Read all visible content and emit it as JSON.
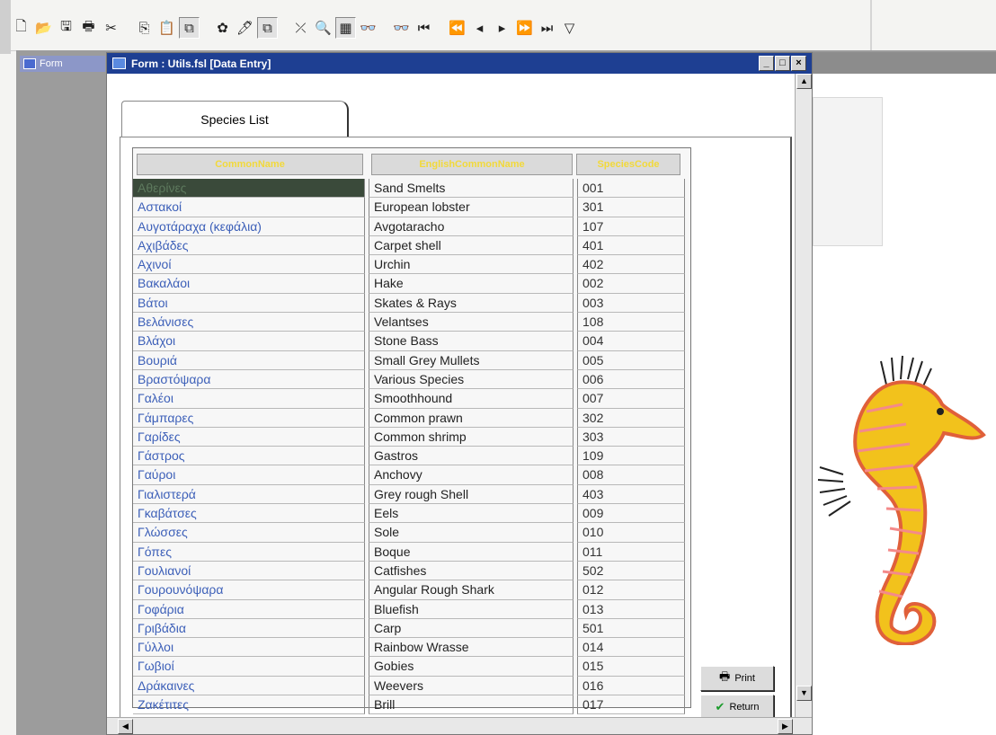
{
  "window": {
    "title": "Form : Utils.fsl [Data Entry]",
    "minimized_title": "Form",
    "controls": [
      "_",
      "□",
      "×"
    ]
  },
  "toolbar": {
    "icons": [
      "new-icon",
      "open-icon",
      "save-icon",
      "print-icon",
      "cut-icon",
      "copy-icon",
      "paste-icon",
      "form-view-icon",
      "layout-icon",
      "wand-icon",
      "filter-select-icon",
      "filter-edit-icon",
      "zoom-icon",
      "table-view-icon",
      "binoculars-icon",
      "find-replace-icon",
      "first-record-icon",
      "prev-page-icon",
      "prev-record-icon",
      "next-record-icon",
      "next-page-icon",
      "last-record-icon",
      "filter-icon"
    ],
    "glyphs": [
      "🗋",
      "📂",
      "🖫",
      "🖶",
      "✂",
      "⎘",
      "📋",
      "⧉",
      "✿",
      "🖊",
      "⧉",
      "⤫",
      "🔍",
      "▦",
      "👓",
      "👓",
      "⏮",
      "⏪",
      "◂",
      "▸",
      "⏩",
      "⏭",
      "▽"
    ]
  },
  "tab": {
    "label": "Species List"
  },
  "table": {
    "headers": [
      "CommonName",
      "EnglishCommonName",
      "SpeciesCode"
    ],
    "rows": [
      [
        "Αθερίνες",
        "Sand Smelts",
        "001"
      ],
      [
        "Αστακοί",
        "European lobster",
        "301"
      ],
      [
        "Αυγοτάραχα (κεφάλια)",
        "Avgotaracho",
        "107"
      ],
      [
        "Αχιβάδες",
        "Carpet shell",
        "401"
      ],
      [
        "Αχινοί",
        "Urchin",
        "402"
      ],
      [
        "Βακαλάοι",
        "Hake",
        "002"
      ],
      [
        "Βάτοι",
        "Skates & Rays",
        "003"
      ],
      [
        "Βελάνισες",
        "Velantses",
        "108"
      ],
      [
        "Βλάχοι",
        "Stone Bass",
        "004"
      ],
      [
        "Βουριά",
        "Small Grey Mullets",
        "005"
      ],
      [
        "Βραστόψαρα",
        "Various Species",
        "006"
      ],
      [
        "Γαλέοι",
        "Smoothhound",
        "007"
      ],
      [
        "Γάμπαρες",
        "Common prawn",
        "302"
      ],
      [
        "Γαρίδες",
        "Common shrimp",
        "303"
      ],
      [
        "Γάστρος",
        "Gastros",
        "109"
      ],
      [
        "Γαύροι",
        "Anchovy",
        "008"
      ],
      [
        "Γιαλιστερά",
        "Grey rough Shell",
        "403"
      ],
      [
        "Γκαβάτσες",
        "Eels",
        "009"
      ],
      [
        "Γλώσσες",
        "Sole",
        "010"
      ],
      [
        "Γόπες",
        "Boque",
        "011"
      ],
      [
        "Γουλιανοί",
        "Catfishes",
        "502"
      ],
      [
        "Γουρουνόψαρα",
        "Angular Rough Shark",
        "012"
      ],
      [
        "Γοφάρια",
        "Bluefish",
        "013"
      ],
      [
        "Γριβάδια",
        "Carp",
        "501"
      ],
      [
        "Γύλλοι",
        "Rainbow Wrasse",
        "014"
      ],
      [
        "Γωβιοί",
        "Gobies",
        "015"
      ],
      [
        "Δράκαινες",
        "Weevers",
        "016"
      ],
      [
        "Ζακέτιτες",
        "Brill",
        "017"
      ]
    ]
  },
  "buttons": {
    "print": {
      "label": "Print",
      "icon": "printer-icon",
      "glyph": "🖶"
    },
    "return": {
      "label": "Return",
      "icon": "checkmark-icon",
      "glyph": "✔"
    }
  },
  "colors": {
    "header_text": "#f2d93a",
    "greek_text": "#3c5fb8",
    "title_bar": "#1e3f92"
  }
}
